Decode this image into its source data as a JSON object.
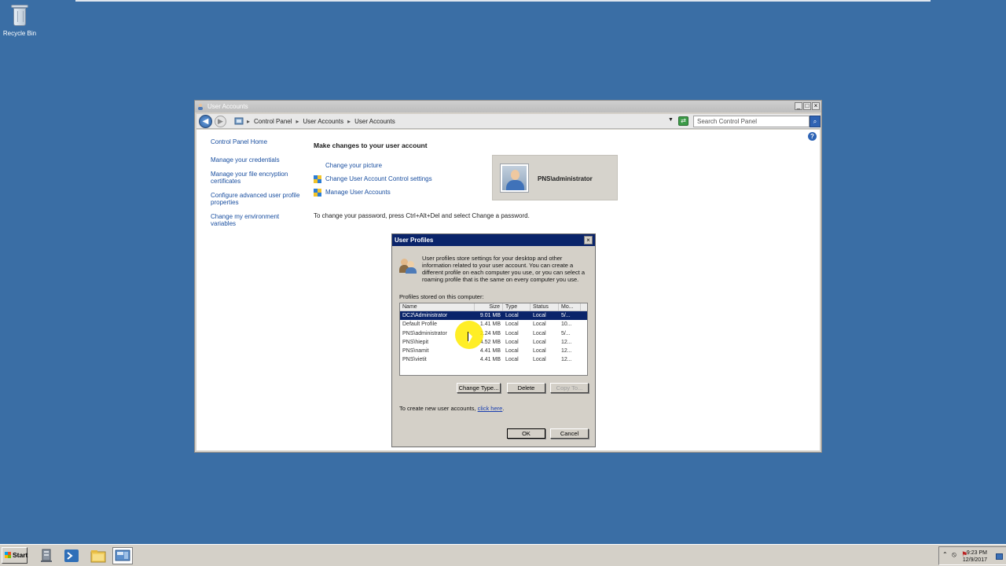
{
  "desktop": {
    "recycle_bin_label": "Recycle Bin"
  },
  "window": {
    "title": "User Accounts",
    "breadcrumbs": [
      "Control Panel",
      "User Accounts",
      "User Accounts"
    ],
    "search_placeholder": "Search Control Panel",
    "left_nav": [
      "Control Panel Home",
      "Manage your credentials",
      "Manage your file encryption certificates",
      "Configure advanced user profile properties",
      "Change my environment variables"
    ],
    "heading": "Make changes to your user account",
    "tasks": [
      "Change your picture",
      "Change User Account Control settings",
      "Manage User Accounts"
    ],
    "password_note": "To change your password, press Ctrl+Alt+Del and select Change a password.",
    "user_name": "PNS\\administrator"
  },
  "dialog": {
    "title": "User Profiles",
    "description": "User profiles store settings for your desktop and other information related to your user account. You can create a different profile on each computer you use, or you can select a roaming profile that is the same on every computer you use.",
    "stored_label": "Profiles stored on this computer:",
    "columns": [
      "Name",
      "Size",
      "Type",
      "Status",
      "Mo..."
    ],
    "rows": [
      [
        "DC2\\Administrator",
        "9.01 MB",
        "Local",
        "Local",
        "5/..."
      ],
      [
        "Default Profile",
        "1.41 MB",
        "Local",
        "Local",
        "10..."
      ],
      [
        "PNS\\administrator",
        "2.24 MB",
        "Local",
        "Local",
        "5/..."
      ],
      [
        "PNS\\hiepit",
        "4.52 MB",
        "Local",
        "Local",
        "12..."
      ],
      [
        "PNS\\namit",
        "4.41 MB",
        "Local",
        "Local",
        "12..."
      ],
      [
        "PNS\\vietit",
        "4.41 MB",
        "Local",
        "Local",
        "12..."
      ]
    ],
    "buttons": {
      "change_type": "Change Type...",
      "delete": "Delete",
      "copy_to": "Copy To...",
      "ok": "OK",
      "cancel": "Cancel"
    },
    "create_note_prefix": "To create new user accounts, ",
    "create_note_link": "click here",
    "create_note_suffix": "."
  },
  "taskbar": {
    "start_label": "Start",
    "time": "9:23 PM",
    "date": "12/9/2017"
  },
  "colors": {
    "desktop": "#3a6ea5",
    "selection": "#0a246a",
    "link": "#1a4fa0",
    "cursor_highlight": "#ffeb00"
  }
}
